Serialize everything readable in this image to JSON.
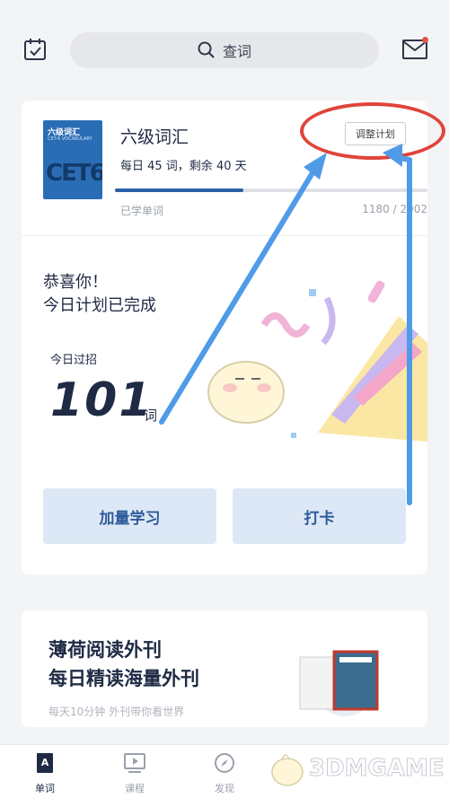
{
  "topbar": {
    "search_label": "查词"
  },
  "book": {
    "cover_title": "六级词汇",
    "cover_sub": "CET-6 VOCABULARY",
    "cover_big": "CET6",
    "title": "六级词汇",
    "plan": "每日 45 词，剩余 40 天",
    "adjust_label": "调整计划",
    "learned_label": "已学单词",
    "learned_count": "1180 / 2902",
    "progress": 0.41
  },
  "congrats": {
    "line1": "恭喜你！",
    "line2": "今日计划已完成",
    "today_label": "今日过招",
    "count": "101",
    "unit": "词"
  },
  "buttons": {
    "more": "加量学习",
    "checkin": "打卡"
  },
  "promo": {
    "line1": "薄荷阅读外刊",
    "line2": "每日精读海量外刊",
    "sub": "每天10分钟 外刊带你看世界"
  },
  "tabs": [
    {
      "label": "单词",
      "icon": "book-a-icon"
    },
    {
      "label": "课程",
      "icon": "screen-play-icon"
    },
    {
      "label": "发现",
      "icon": "compass-icon"
    }
  ],
  "watermark": "3DMGAME",
  "colors": {
    "accent": "#2b5fa8",
    "annotation_red": "#e0443a",
    "annotation_blue": "#4f9be8"
  }
}
